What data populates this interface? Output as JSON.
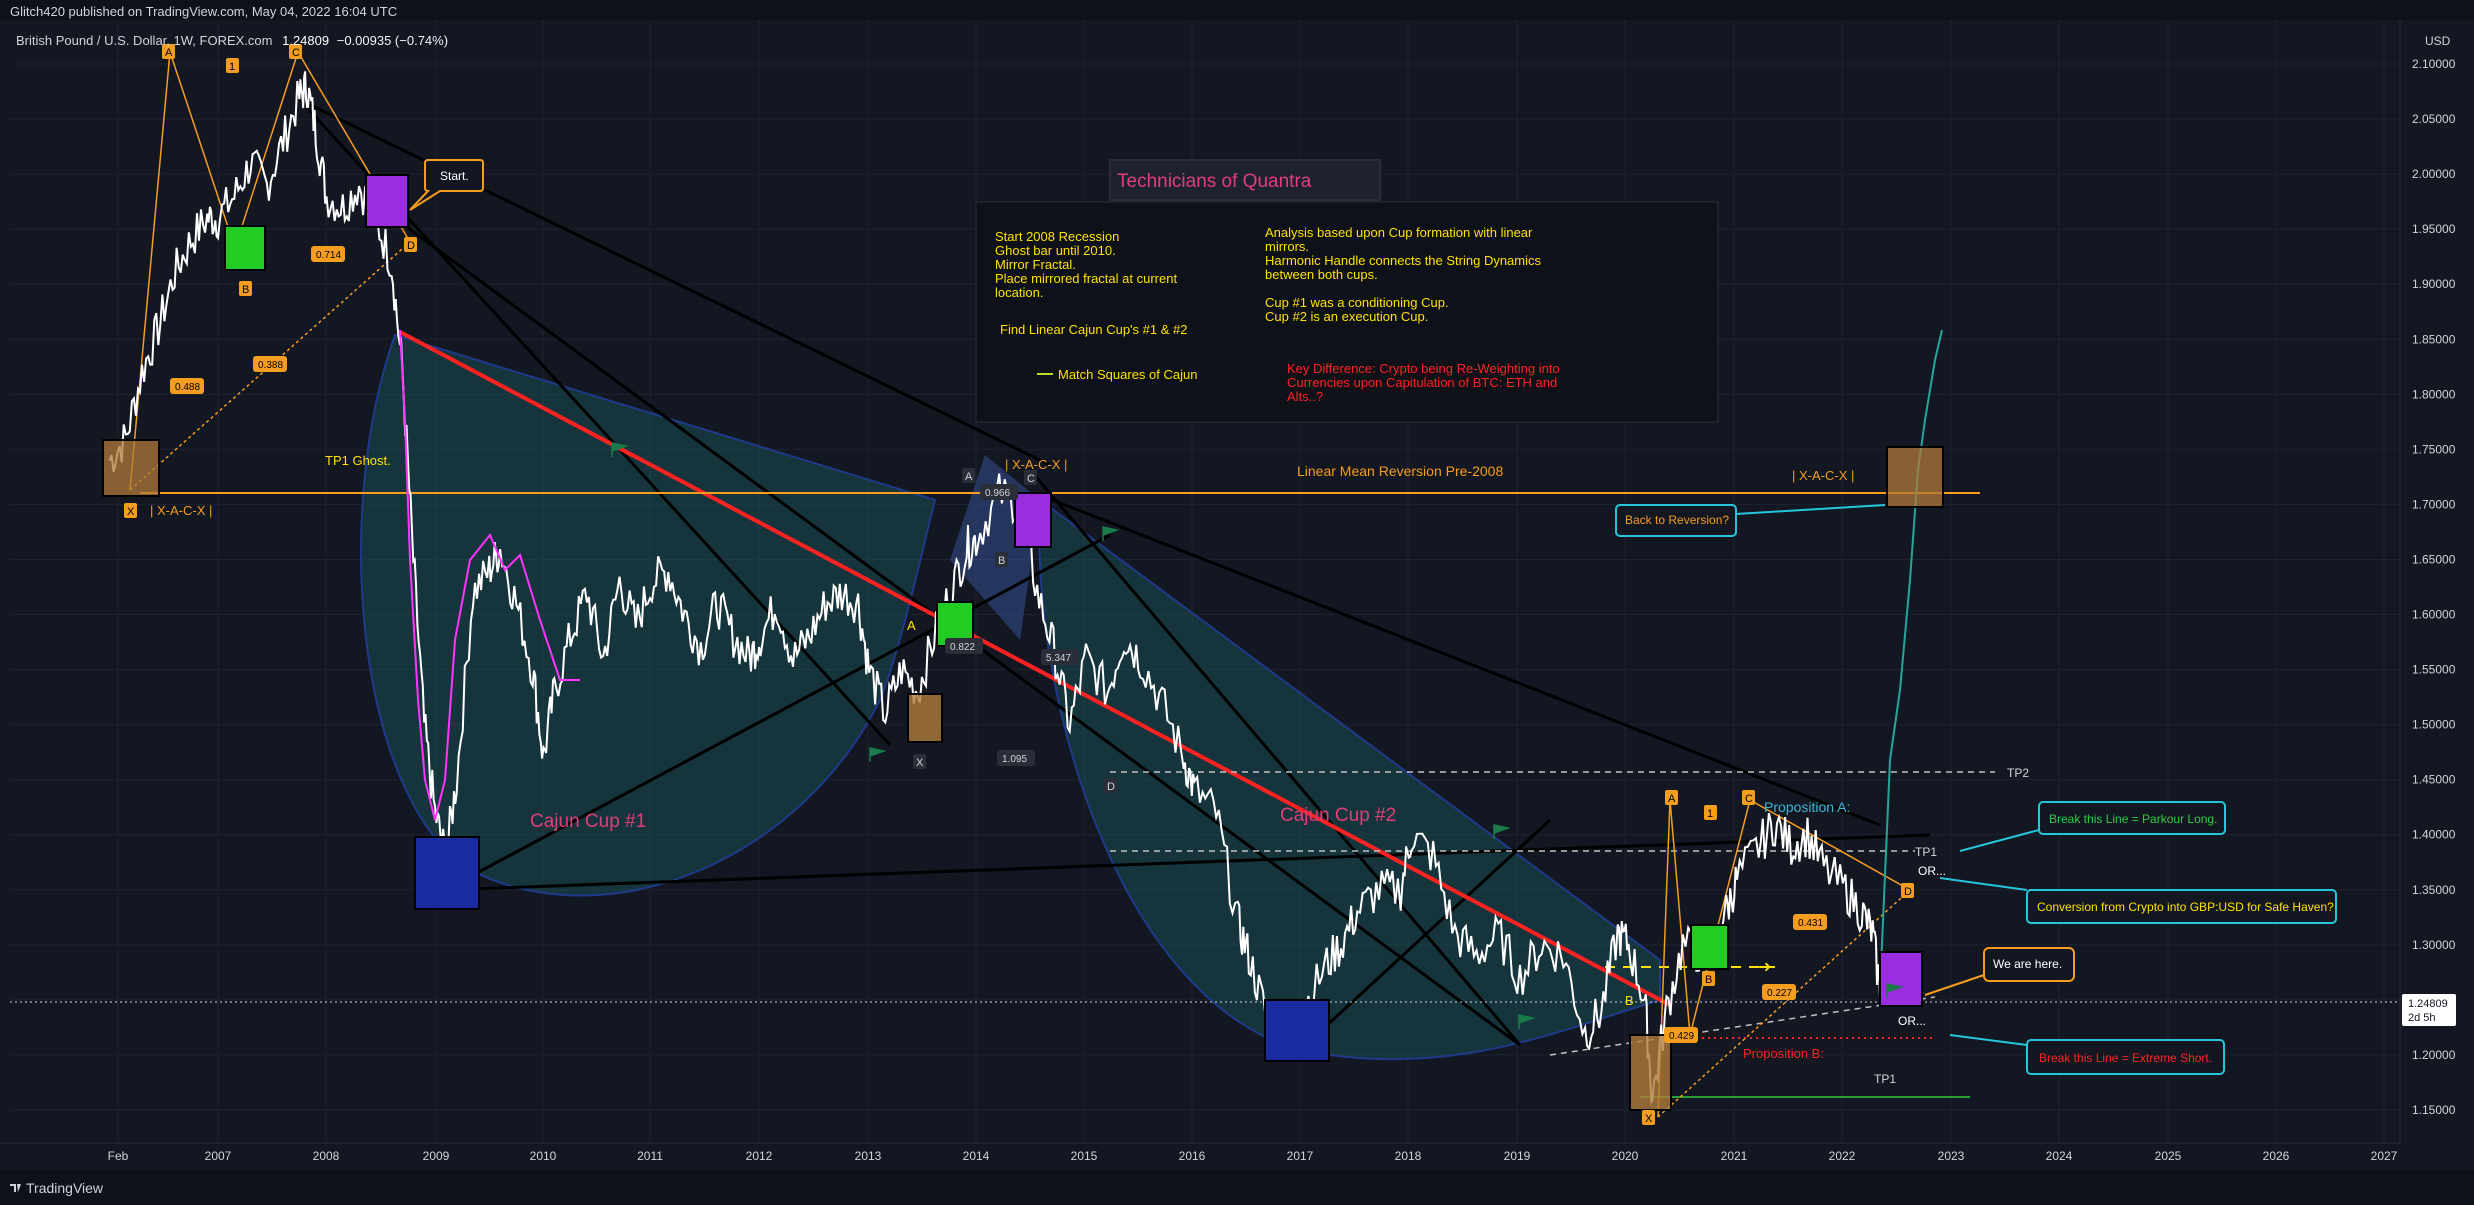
{
  "header": {
    "publisher": "Glitch420 published on TradingView.com, May 04, 2022 16:04 UTC"
  },
  "symbol": {
    "name": "British Pound / U.S. Dollar, 1W, FOREX.com",
    "price": "1.24809",
    "change": "−0.00935 (−0.74%)"
  },
  "footer": {
    "brand": "TradingView"
  },
  "chart_data": {
    "type": "line",
    "currency": "USD",
    "price_label": {
      "value": "1.24809",
      "countdown": "2d 5h"
    },
    "x_ticks": [
      "Feb",
      "2007",
      "2008",
      "2009",
      "2010",
      "2011",
      "2012",
      "2013",
      "2014",
      "2015",
      "2016",
      "2017",
      "2018",
      "2019",
      "2020",
      "2021",
      "2022",
      "2023",
      "2024",
      "2025",
      "2026",
      "2027"
    ],
    "y_ticks": [
      "2.10000",
      "2.05000",
      "2.00000",
      "1.95000",
      "1.90000",
      "1.85000",
      "1.80000",
      "1.75000",
      "1.70000",
      "1.65000",
      "1.60000",
      "1.55000",
      "1.50000",
      "1.45000",
      "1.40000",
      "1.35000",
      "1.30000",
      "1.25000",
      "1.20000",
      "1.15000"
    ],
    "ylim": [
      1.12,
      2.14
    ],
    "xlim": [
      2006.0,
      2027.2
    ],
    "series": [
      {
        "x": [
          2006.0,
          2006.15,
          2006.3,
          2006.45,
          2006.6,
          2006.75,
          2006.9,
          2007.0,
          2007.15,
          2007.3,
          2007.45,
          2007.6,
          2007.75,
          2007.82,
          2007.9,
          2008.0,
          2008.15,
          2008.3,
          2008.45,
          2008.6,
          2008.7,
          2008.8,
          2008.9,
          2009.0,
          2009.1,
          2009.2,
          2009.35,
          2009.5,
          2009.6,
          2009.75,
          2009.9,
          2010.0,
          2010.1,
          2010.25,
          2010.4,
          2010.55,
          2010.7,
          2010.85,
          2011.0,
          2011.15,
          2011.3,
          2011.45,
          2011.6,
          2011.75,
          2011.9,
          2012.0,
          2012.15,
          2012.3,
          2012.45,
          2012.6,
          2012.75,
          2012.9,
          2013.0,
          2013.15,
          2013.3,
          2013.45,
          2013.6,
          2013.75,
          2013.9,
          2014.0,
          2014.2,
          2014.4,
          2014.55,
          2014.7,
          2014.85,
          2015.0,
          2015.2,
          2015.35,
          2015.5,
          2015.7,
          2015.9,
          2016.0,
          2016.2,
          2016.4,
          2016.5,
          2016.65,
          2016.8,
          2016.9,
          2017.0,
          2017.2,
          2017.35,
          2017.5,
          2017.7,
          2017.9,
          2018.0,
          2018.2,
          2018.4,
          2018.6,
          2018.8,
          2019.0,
          2019.2,
          2019.4,
          2019.6,
          2019.75,
          2019.9,
          2020.0,
          2020.15,
          2020.22,
          2020.35,
          2020.5,
          2020.7,
          2020.9,
          2021.0,
          2021.2,
          2021.35,
          2021.5,
          2021.65,
          2021.8,
          2022.0,
          2022.15,
          2022.25,
          2022.33
        ],
        "y": [
          1.74,
          1.76,
          1.82,
          1.86,
          1.91,
          1.94,
          1.96,
          1.96,
          1.98,
          2.01,
          1.99,
          2.03,
          2.07,
          2.08,
          2.04,
          1.98,
          1.97,
          1.99,
          1.96,
          1.92,
          1.82,
          1.65,
          1.5,
          1.42,
          1.38,
          1.45,
          1.62,
          1.64,
          1.66,
          1.61,
          1.55,
          1.47,
          1.53,
          1.58,
          1.62,
          1.56,
          1.63,
          1.59,
          1.63,
          1.64,
          1.6,
          1.57,
          1.61,
          1.58,
          1.56,
          1.58,
          1.61,
          1.56,
          1.58,
          1.61,
          1.62,
          1.61,
          1.55,
          1.51,
          1.55,
          1.53,
          1.58,
          1.62,
          1.66,
          1.67,
          1.71,
          1.7,
          1.62,
          1.57,
          1.5,
          1.56,
          1.53,
          1.58,
          1.56,
          1.52,
          1.47,
          1.44,
          1.42,
          1.32,
          1.29,
          1.24,
          1.22,
          1.23,
          1.24,
          1.28,
          1.3,
          1.33,
          1.35,
          1.35,
          1.4,
          1.38,
          1.31,
          1.29,
          1.31,
          1.27,
          1.3,
          1.29,
          1.22,
          1.24,
          1.31,
          1.3,
          1.25,
          1.16,
          1.24,
          1.3,
          1.29,
          1.33,
          1.36,
          1.39,
          1.41,
          1.39,
          1.4,
          1.37,
          1.35,
          1.33,
          1.31,
          1.25
        ]
      }
    ]
  },
  "annotations": {
    "title_box": "Technicians of Quantra",
    "info_left": [
      "Start 2008 Recession",
      "Ghost bar until 2010.",
      "Mirror Fractal.",
      "Place mirrored fractal at current",
      "location."
    ],
    "info_find": "Find Linear Cajun Cup's #1 & #2",
    "info_match": "Match Squares of Cajun",
    "info_right": [
      "Analysis based upon Cup formation with linear",
      "mirrors.",
      "Harmonic Handle connects the String Dynamics",
      "between both cups.",
      "",
      "Cup #1 was a conditioning Cup.",
      "Cup #2 is an execution Cup."
    ],
    "info_red": [
      "Key Difference: Crypto being  Re-Weighting into",
      "Currencies upon Capitulation of BTC: ETH and",
      "Alts..?"
    ],
    "cup1": "Cajun Cup #1",
    "cup2": "Cajun Cup #2",
    "start": "Start.",
    "tp1_ghost": "TP1 Ghost.",
    "xacx_left": "| X-A-C-X |",
    "xacx_mid": "| X-A-C-X |",
    "xacx_right": "| X-A-C-X |",
    "linear_mean": "Linear Mean Reversion Pre-2008",
    "back_reversion": "Back to Reversion?",
    "proposition_a": "Proposition A:",
    "proposition_b": "Proposition B:",
    "break_long": "Break this Line = Parkour Long.",
    "conversion": "Conversion from Crypto into GBP:USD for Safe Haven?",
    "we_are_here": "We are here.",
    "break_short": "Break this Line = Extreme Short.",
    "tp2": "TP2",
    "tp1a": "TP1",
    "tp1b": "TP1",
    "or1": "OR...",
    "or2": "OR...",
    "fib_0488": "0.488",
    "fib_0388": "0.388",
    "fib_0714": "0.714",
    "fib_0966": "0.966",
    "fib_0822": "0.822",
    "fib_5347": "5.347",
    "fib_1095": "1.095",
    "fib_0431": "0.431",
    "fib_0227": "0.227",
    "fib_0429": "0.429",
    "pt_a1": "A",
    "pt_c1": "C",
    "pt_x1": "X",
    "pt_b1": "B",
    "pt_d1": "D",
    "pt_11": "1",
    "pt_a2": "A",
    "pt_c2": "C",
    "pt_x2": "X",
    "pt_b2": "B",
    "pt_d2": "D",
    "pt_a3": "A",
    "pt_c3": "C",
    "pt_x3": "X",
    "pt_b3": "B",
    "pt_d3": "D",
    "pt_13": "1",
    "pt_a_yellow": "A",
    "pt_b_yellow": "B"
  }
}
